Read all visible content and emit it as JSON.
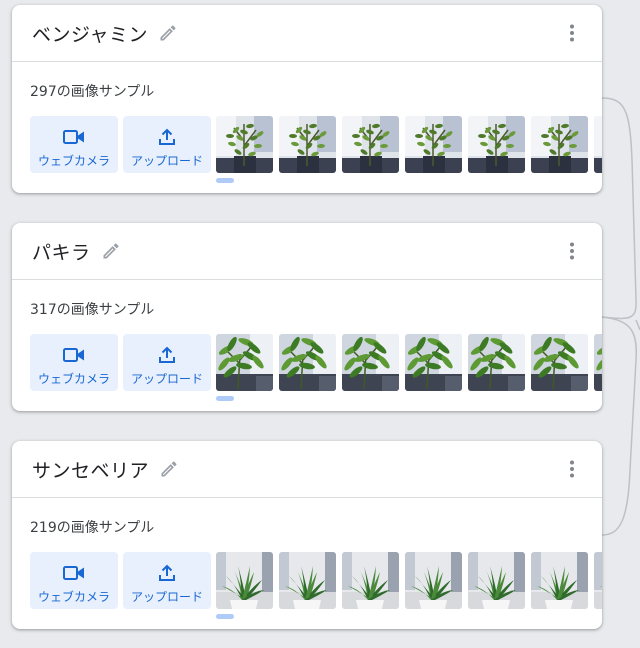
{
  "colors": {
    "accent": "#1967d2",
    "button_bg": "#e8f0fe",
    "divider": "#dadce0",
    "background": "#e8eaed"
  },
  "classes": [
    {
      "name": "ベンジャミン",
      "sample_count": "297の画像サンプル",
      "webcam_label": "ウェブカメラ",
      "upload_label": "アップロード",
      "thumbnail_subject": "ficus-plant"
    },
    {
      "name": "パキラ",
      "sample_count": "317の画像サンプル",
      "webcam_label": "ウェブカメラ",
      "upload_label": "アップロード",
      "thumbnail_subject": "pachira-plant"
    },
    {
      "name": "サンセベリア",
      "sample_count": "219の画像サンプル",
      "webcam_label": "ウェブカメラ",
      "upload_label": "アップロード",
      "thumbnail_subject": "sansevieria-plant"
    }
  ]
}
